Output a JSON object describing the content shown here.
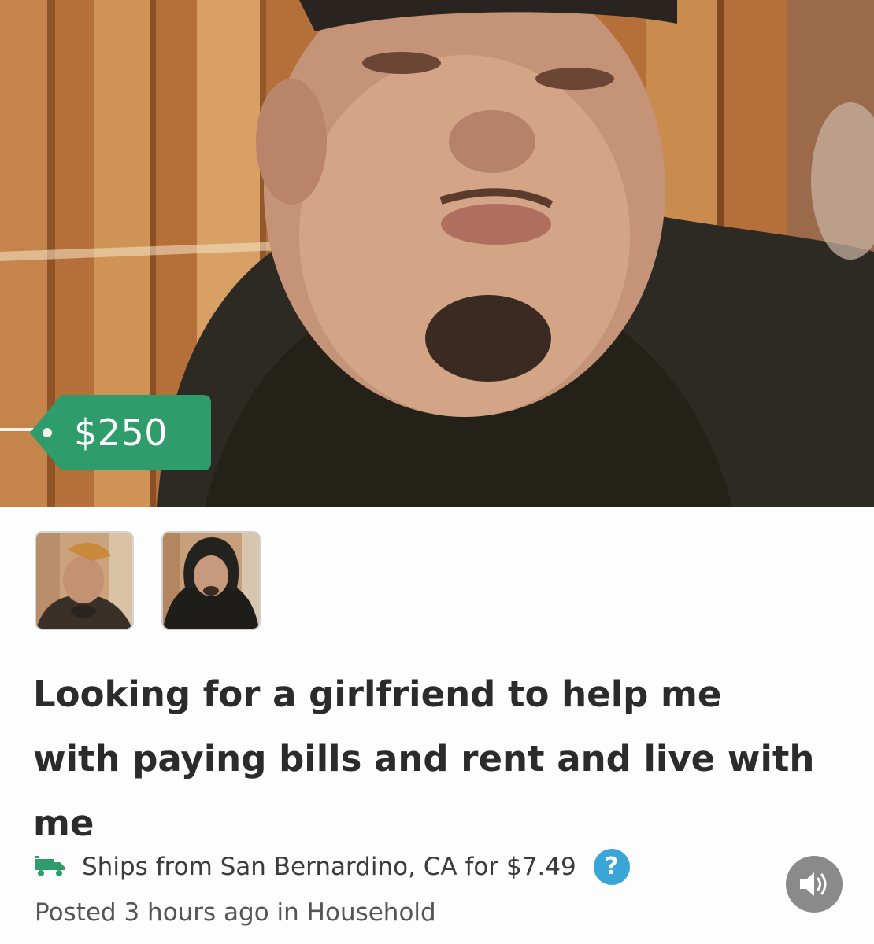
{
  "listing": {
    "price": "$250",
    "title": "Looking for a girlfriend to help me with paying bills and rent and live with me",
    "shipping_text": "Ships from San Bernardino, CA for $7.49",
    "help_glyph": "?",
    "posted_text": "Posted 3 hours ago in Household",
    "thumbnail_count": 2,
    "selected_thumbnail": 2
  },
  "icons": {
    "shipping": "truck-icon",
    "help": "question-circle-icon",
    "sound": "speaker-volume-icon"
  },
  "colors": {
    "price_tag": "#2e9c6b",
    "help_icon": "#3aa6d8",
    "sound_button": "#8a8a8a",
    "shipping_icon": "#2e9c6b",
    "title_text": "#2b2b2b"
  }
}
